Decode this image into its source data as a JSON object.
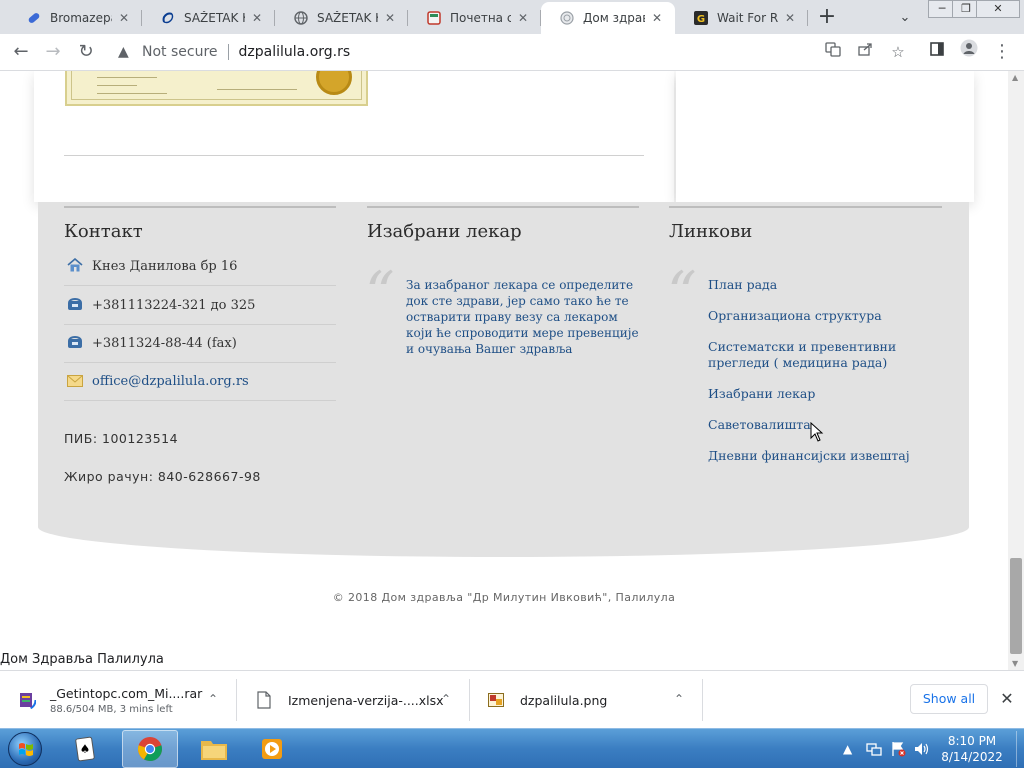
{
  "browser": {
    "tabs": [
      {
        "title": "Bromazepam",
        "icon": "pill-favicon-icon",
        "icon_color": "#3b6ad6",
        "active": false
      },
      {
        "title": "SAŽETAK KARAKTERISTIKA",
        "icon": "swirl-favicon-icon",
        "icon_color": "#0a3d91",
        "active": false
      },
      {
        "title": "SAŽETAK KARAKTERISTIKA",
        "icon": "globe-favicon-icon",
        "icon_color": "#5f6368",
        "active": false
      },
      {
        "title": "Почетна страна",
        "icon": "site-favicon-icon",
        "icon_color": "#c0392b",
        "active": false
      },
      {
        "title": "Дом здравља",
        "icon": "globe-favicon-icon",
        "icon_color": "#9aa0a6",
        "active": true
      },
      {
        "title": "Wait For Response",
        "icon": "g-favicon-icon",
        "icon_color": "#2b2b2b",
        "active": false
      }
    ],
    "new_tab_label": "+",
    "security_label": "Not secure",
    "url": "dzpalilula.org.rs"
  },
  "page": {
    "contact": {
      "title": "Контакт",
      "rows": [
        {
          "icon": "home-icon",
          "glyph": "⌂",
          "value": "Кнез Данилова бр 16",
          "link": false
        },
        {
          "icon": "phone-icon",
          "glyph": "☎",
          "value": "+381113224-321 до 325",
          "link": false
        },
        {
          "icon": "fax-icon",
          "glyph": "☎",
          "value": "+3811324-88-44 (fax)",
          "link": false
        },
        {
          "icon": "mail-icon",
          "glyph": "✉",
          "value": "office@dzpalilula.org.rs",
          "link": true
        }
      ],
      "pib": "ПИБ: 100123514",
      "account": "Жиро рачун: 840-628667-98"
    },
    "doctor": {
      "title": "Изабрани лекар",
      "text": "За изабраног лекара се определите док сте здрави, јер само тако ће те остварити праву везу са лекаром који ће спроводити мере превенције и очувања Вашег здравља"
    },
    "links": {
      "title": "Линкови",
      "items": [
        "План рада",
        "Организациона структура",
        "Систематски и превентивни прегледи ( медицина рада)",
        "Изабрани лекар",
        "Саветовалишта",
        "Дневни финансијски извештај"
      ]
    },
    "copyright": "© 2018 Дом здравља \"Др Милутин Ивковић\", Палилула",
    "status_tooltip": "Дом Здравља Палилула"
  },
  "downloads": {
    "items": [
      {
        "name": "_Getintopc.com_Mi....rar",
        "status": "88.6/504 MB, 3 mins left",
        "icon": "rar-file-icon"
      },
      {
        "name": "Izmenjena-verzija-....xlsx",
        "status": "",
        "icon": "document-file-icon"
      },
      {
        "name": "dzpalilula.png",
        "status": "",
        "icon": "image-file-icon"
      }
    ],
    "show_all_label": "Show all"
  },
  "taskbar": {
    "clock_time": "8:10 PM",
    "clock_date": "8/14/2022",
    "apps": [
      "solitaire-app-icon",
      "chrome-app-icon",
      "file-explorer-icon",
      "media-player-icon"
    ]
  },
  "colors": {
    "footer_bg": "#e2e2e2",
    "link": "#1f4f86",
    "accent_blue": "#1a73e8",
    "taskbar": "#3b7ec2"
  }
}
